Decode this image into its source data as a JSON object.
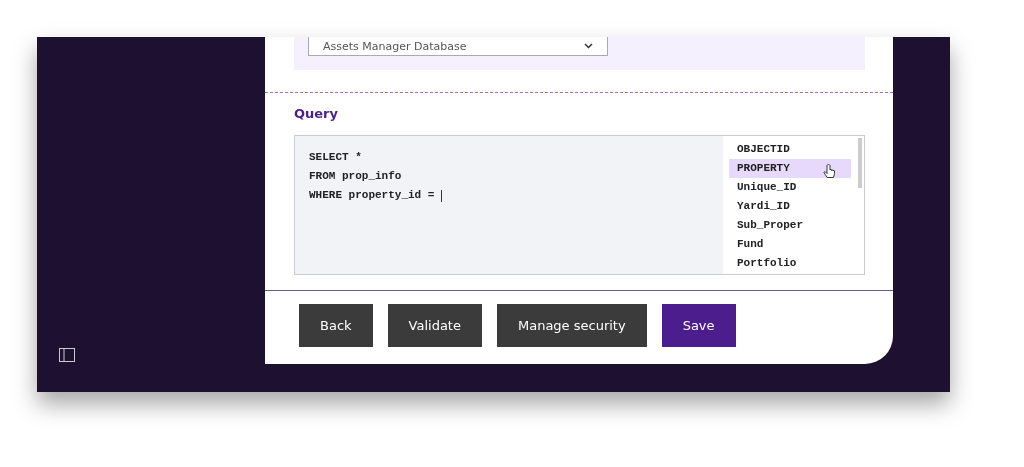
{
  "data_source": {
    "value": "Assets Manager Database"
  },
  "query": {
    "label": "Query",
    "lines": [
      "SELECT *",
      "FROM prop_info",
      "WHERE property_id = "
    ],
    "suggestions": [
      {
        "label": "OBJECTID",
        "selected": false
      },
      {
        "label": "PROPERTY",
        "selected": true
      },
      {
        "label": "Unique_ID",
        "selected": false
      },
      {
        "label": "Yardi_ID",
        "selected": false
      },
      {
        "label": "Sub_Proper",
        "selected": false
      },
      {
        "label": "Fund",
        "selected": false
      },
      {
        "label": "Portfolio",
        "selected": false
      }
    ]
  },
  "buttons": [
    {
      "label": "Back",
      "kind": "secondary"
    },
    {
      "label": "Validate",
      "kind": "secondary"
    },
    {
      "label": "Manage security",
      "kind": "secondary"
    },
    {
      "label": "Save",
      "kind": "primary"
    }
  ]
}
